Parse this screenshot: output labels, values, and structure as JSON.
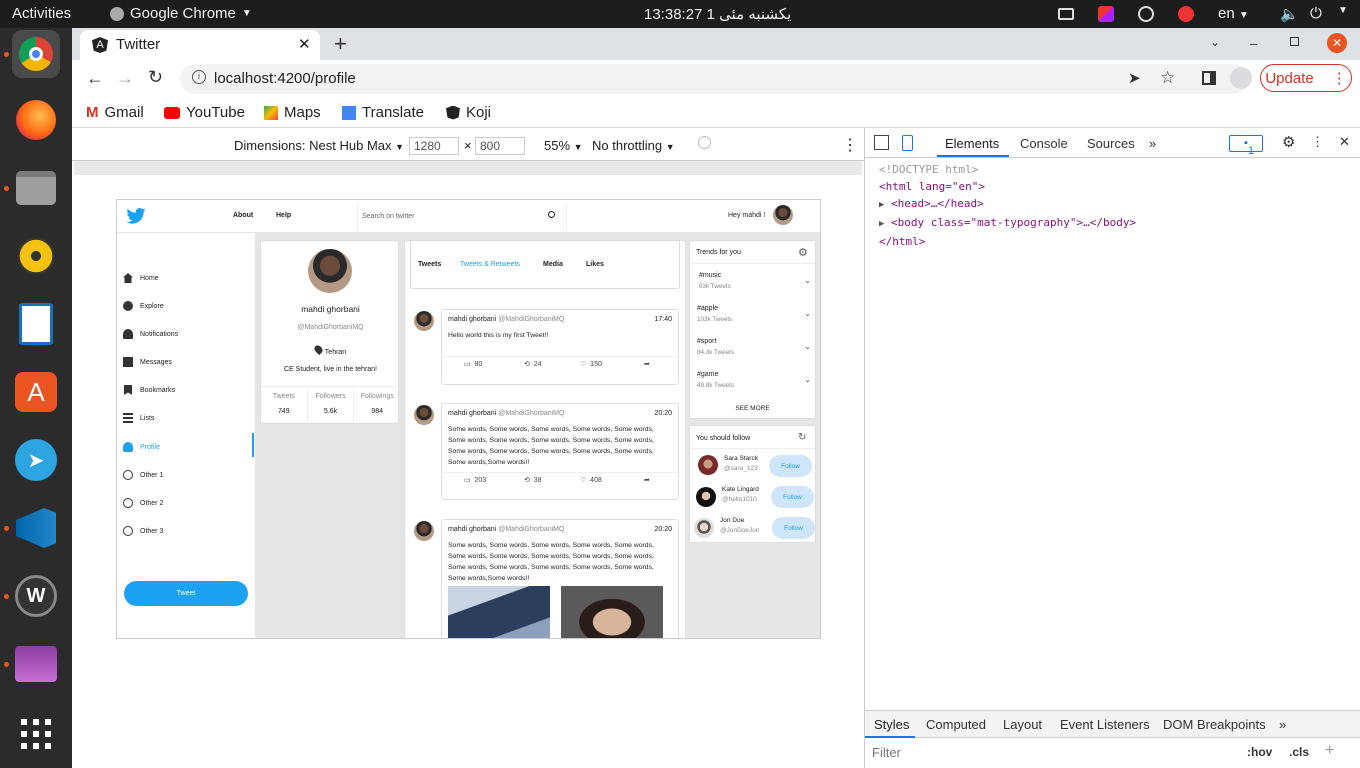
{
  "system": {
    "activities": "Activities",
    "app_menu": "Google Chrome",
    "clock": "13:38:27  یکشنبه مئی 1",
    "lang": "en"
  },
  "browser": {
    "tab_title": "Twitter",
    "url": "localhost:4200/profile",
    "update_label": "Update",
    "bookmarks": [
      "Gmail",
      "YouTube",
      "Maps",
      "Translate",
      "Koji"
    ]
  },
  "device_toolbar": {
    "dimensions_label": "Dimensions: Nest Hub Max",
    "width": "1280",
    "height": "800",
    "times": "×",
    "zoom": "55%",
    "throttle": "No throttling"
  },
  "twitter": {
    "header": {
      "about": "About",
      "help": "Help",
      "search_placeholder": "Search on twitter",
      "greeting": "Hey mahdi !"
    },
    "nav": [
      {
        "label": "Home"
      },
      {
        "label": "Explore"
      },
      {
        "label": "Notifications"
      },
      {
        "label": "Messages"
      },
      {
        "label": "Bookmarks"
      },
      {
        "label": "Lists"
      },
      {
        "label": "Profile"
      },
      {
        "label": "Other 1"
      },
      {
        "label": "Other 2"
      },
      {
        "label": "Other 3"
      }
    ],
    "tweet_button": "Tweet",
    "profile": {
      "name": "mahdi ghorbani",
      "handle": "@MahdiGhorbaniMQ",
      "location": "Tehran",
      "bio": "CE Student, live in the tehran!",
      "stats": [
        {
          "label": "Tweets",
          "value": "749"
        },
        {
          "label": "Followers",
          "value": "5.6k"
        },
        {
          "label": "Followings",
          "value": "984"
        }
      ]
    },
    "feed_tabs": [
      "Tweets",
      "Tweets & Retweets",
      "Media",
      "Likes"
    ],
    "tweets": [
      {
        "name": "mahdi ghorbani",
        "handle": "@MahdiGhorbaniMQ",
        "time": "17:40",
        "text": "Hello world this is my first Tweet!!",
        "replies": "80",
        "retweets": "24",
        "likes": "150"
      },
      {
        "name": "mahdi ghorbani",
        "handle": "@MahdiGhorbaniMQ",
        "time": "20:20",
        "text": "Some words, Some words, Some words, Some words, Some words, Some words, Some words, Some words, Some words, Some words, Some words, Some words, Some words, Some words, Some words, Some words,Some words!!",
        "replies": "203",
        "retweets": "38",
        "likes": "408"
      },
      {
        "name": "mahdi ghorbani",
        "handle": "@MahdiGhorbaniMQ",
        "time": "20:20",
        "text": "Some words, Some words, Some words, Some words, Some words, Some words, Some words, Some words, Some words, Some words, Some words, Some words, Some words, Some words, Some words, Some words,Some words!!"
      }
    ],
    "trends": {
      "title": "Trends for you",
      "items": [
        {
          "tag": "#music",
          "count": "63k Tweets"
        },
        {
          "tag": "#apple",
          "count": "103k Tweets"
        },
        {
          "tag": "#sport",
          "count": "84.3k Tweets"
        },
        {
          "tag": "#game",
          "count": "49.8k Tweets"
        }
      ],
      "see_more": "SEE MORE"
    },
    "who_to_follow": {
      "title": "You should follow",
      "follow_label": "Follow",
      "users": [
        {
          "name": "Sara Starck",
          "handle": "@sara_123"
        },
        {
          "name": "Kate Lingard",
          "handle": "@hello1010"
        },
        {
          "name": "Jon Doe",
          "handle": "@JonDoeJon"
        }
      ]
    }
  },
  "devtools": {
    "tabs": [
      "Elements",
      "Console",
      "Sources"
    ],
    "issues_count": "1",
    "code": {
      "doctype": "<!DOCTYPE html>",
      "html_open": "<html lang=\"en\">",
      "head": "<head>…</head>",
      "body": "<body class=\"mat-typography\">…</body>",
      "html_close": "</html>"
    },
    "bottom_tabs": [
      "Styles",
      "Computed",
      "Layout",
      "Event Listeners",
      "DOM Breakpoints"
    ],
    "filter_placeholder": "Filter",
    "hov": ":hov",
    "cls": ".cls"
  },
  "colors": {
    "twitter_blue": "#1da1f2",
    "update_red": "#d93025"
  }
}
